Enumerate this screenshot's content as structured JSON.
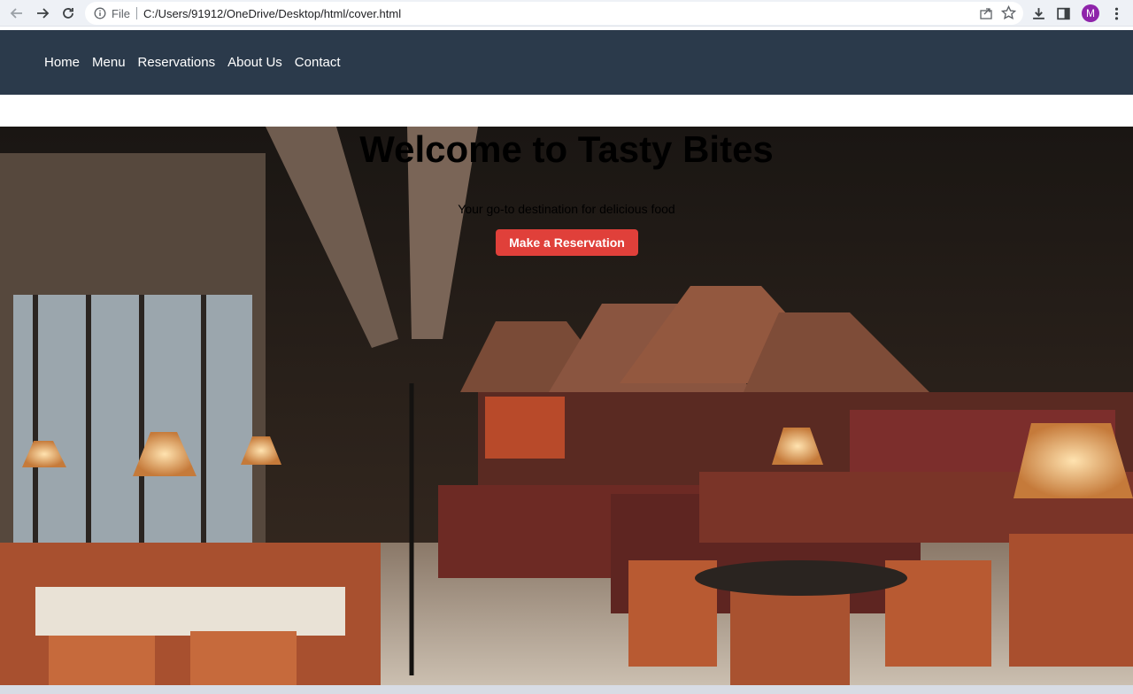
{
  "browser": {
    "scheme_label": "File",
    "url": "C:/Users/91912/OneDrive/Desktop/html/cover.html",
    "profile_initial": "M",
    "icons": [
      "back-arrow-icon",
      "forward-arrow-icon",
      "reload-icon",
      "info-icon",
      "share-icon",
      "star-icon",
      "download-icon",
      "side-panel-icon",
      "kebab-menu-icon"
    ]
  },
  "nav": {
    "items": [
      {
        "label": "Home"
      },
      {
        "label": "Menu"
      },
      {
        "label": "Reservations"
      },
      {
        "label": "About Us"
      },
      {
        "label": "Contact"
      }
    ]
  },
  "hero": {
    "title": "Welcome to Tasty Bites",
    "subtitle": "Your go-to destination for delicious food",
    "cta_label": "Make a Reservation"
  },
  "colors": {
    "nav_bg": "#2b3a4b",
    "cta_bg": "#e0403a",
    "avatar_bg": "#8e24aa"
  }
}
